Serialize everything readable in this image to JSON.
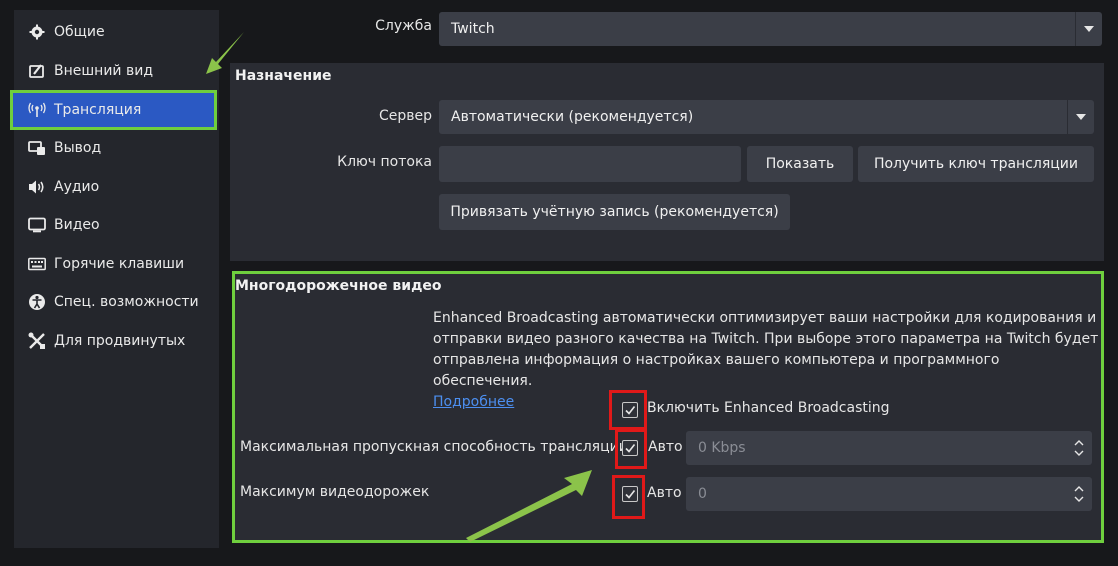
{
  "sidebar": {
    "items": [
      {
        "label": "Общие",
        "icon": "gear-icon"
      },
      {
        "label": "Внешний вид",
        "icon": "appearance-icon"
      },
      {
        "label": "Трансляция",
        "icon": "broadcast-icon"
      },
      {
        "label": "Вывод",
        "icon": "output-icon"
      },
      {
        "label": "Аудио",
        "icon": "speaker-icon"
      },
      {
        "label": "Видео",
        "icon": "monitor-icon"
      },
      {
        "label": "Горячие клавиши",
        "icon": "keyboard-icon"
      },
      {
        "label": "Спец. возможности",
        "icon": "accessibility-icon"
      },
      {
        "label": "Для продвинутых",
        "icon": "tools-icon"
      }
    ],
    "active_index": 2
  },
  "service": {
    "label": "Служба",
    "value": "Twitch"
  },
  "destination": {
    "title": "Назначение",
    "server_label": "Сервер",
    "server_value": "Автоматически (рекомендуется)",
    "key_label": "Ключ потока",
    "key_value": "",
    "show_button": "Показать",
    "get_key_button": "Получить ключ трансляции",
    "connect_button": "Привязать учётную запись (рекомендуется)"
  },
  "multitrack": {
    "title": "Многодорожечное видео",
    "desc_line1": "Enhanced Broadcasting автоматически оптимизирует ваши настройки для кодирования и",
    "desc_line2": "отправки видео разного качества на Twitch. При выборе этого параметра на Twitch будет",
    "desc_line3": "отправлена информация о настройках вашего компьютера и программного обеспечения.",
    "more_link": "Подробнее",
    "enable_label": "Включить Enhanced Broadcasting",
    "enable_checked": true,
    "bandwidth_label": "Максимальная пропускная способность трансляции",
    "bandwidth_auto_label": "Авто",
    "bandwidth_auto_checked": true,
    "bandwidth_value": "0 Kbps",
    "tracks_label": "Максимум видеодорожек",
    "tracks_auto_label": "Авто",
    "tracks_auto_checked": true,
    "tracks_value": "0"
  },
  "colors": {
    "highlight_green": "#6fcf3e",
    "highlight_red": "#e01919",
    "active_blue": "#2b59c3",
    "link": "#4c8ff0"
  }
}
